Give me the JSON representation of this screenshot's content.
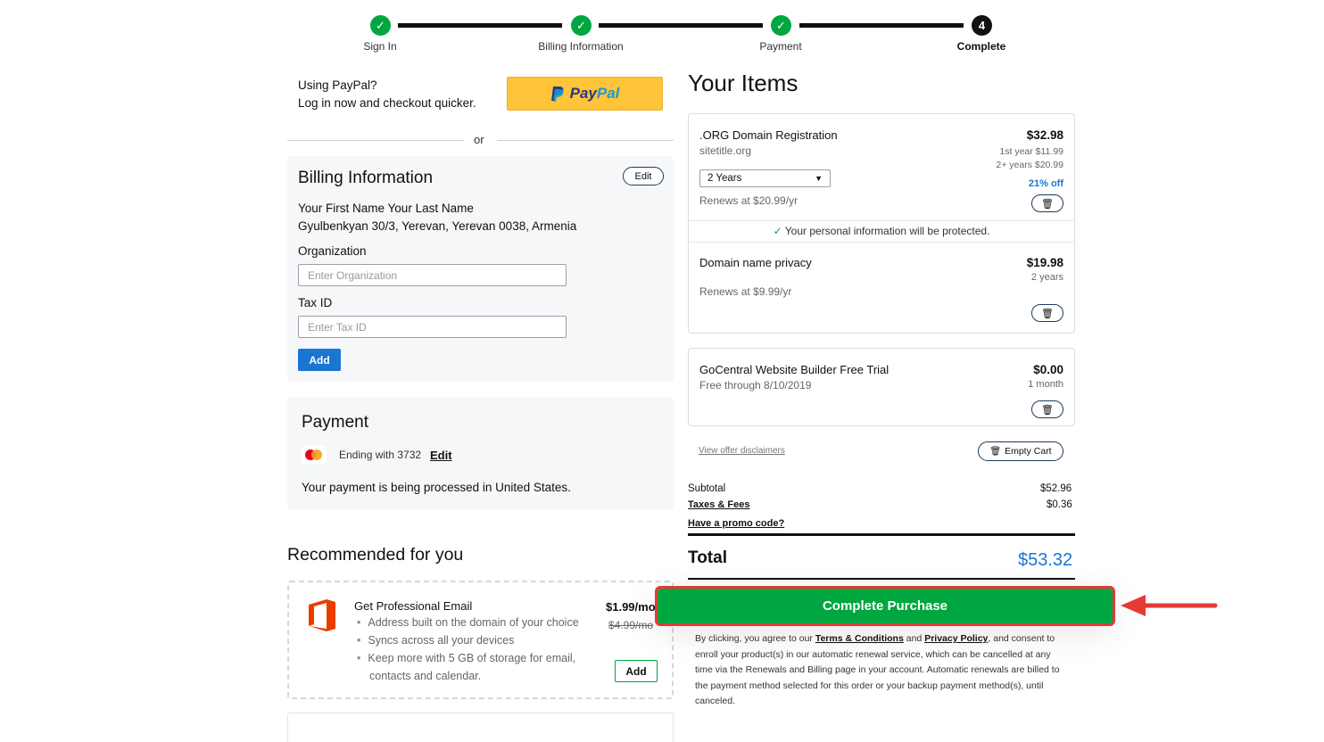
{
  "stepper": {
    "steps": [
      {
        "label": "Sign In",
        "state": "done"
      },
      {
        "label": "Billing Information",
        "state": "done"
      },
      {
        "label": "Payment",
        "state": "done"
      },
      {
        "label": "Complete",
        "state": "current",
        "number": "4"
      }
    ]
  },
  "paypal": {
    "heading": "Using PayPal?",
    "subtext": "Log in now and checkout quicker.",
    "button_pay": "Pay",
    "button_pal": "Pal",
    "divider": "or"
  },
  "billing": {
    "title": "Billing Information",
    "edit_label": "Edit",
    "name": "Your First Name Your Last Name",
    "address": "Gyulbenkyan 30/3, Yerevan, Yerevan 0038, Armenia",
    "org_label": "Organization",
    "org_placeholder": "Enter Organization",
    "tax_label": "Tax ID",
    "tax_placeholder": "Enter Tax ID",
    "add_label": "Add"
  },
  "payment": {
    "title": "Payment",
    "card_text": "Ending with 3732",
    "edit_label": "Edit",
    "note": "Your payment is being processed in United States."
  },
  "recommended": {
    "title": "Recommended for you",
    "item_title": "Get Professional Email",
    "price": "$1.99/mo",
    "old_price": "$4.99/mo",
    "bullets": [
      "Address built on the domain of your choice",
      "Syncs across all your devices",
      "Keep more with 5 GB of storage for email,",
      "contacts and calendar."
    ],
    "add_label": "Add"
  },
  "items": {
    "title": "Your Items",
    "domain": {
      "name": ".ORG Domain Registration",
      "sub": "sitetitle.org",
      "price": "$32.98",
      "first_year": "1st year $11.99",
      "later_years": "2+ years $20.99",
      "term": "2 Years",
      "renews": "Renews at $20.99/yr",
      "discount": "21% off"
    },
    "protected_note": "Your personal information will be protected.",
    "privacy": {
      "name": "Domain name privacy",
      "price": "$19.98",
      "term": "2 years",
      "renews": "Renews at $9.99/yr"
    },
    "builder": {
      "name": "GoCentral Website Builder Free Trial",
      "sub": "Free through 8/10/2019",
      "price": "$0.00",
      "term": "1 month"
    },
    "disclaimers": "View offer disclaimers",
    "empty_cart": "Empty Cart"
  },
  "summary": {
    "subtotal_label": "Subtotal",
    "subtotal": "$52.96",
    "taxes_label": "Taxes & Fees",
    "taxes": "$0.36",
    "promo_label": "Have a promo code?",
    "total_label": "Total",
    "total": "$53.32",
    "cta": "Complete Purchase",
    "legal_pre": "By clicking, you agree to our",
    "terms": "Terms & Conditions",
    "and": "and",
    "privacy": "Privacy Policy",
    "legal_post": ", and consent to enroll your product(s) in our automatic renewal service, which can be cancelled at any time via the Renewals and Billing page in your account. Automatic renewals are billed to the payment method selected for this order or your backup payment method(s), until canceled."
  },
  "colors": {
    "accent_green": "#00a63f",
    "link_blue": "#1976d2",
    "annotation_red": "#e53935",
    "paypal_yellow": "#ffc439"
  }
}
